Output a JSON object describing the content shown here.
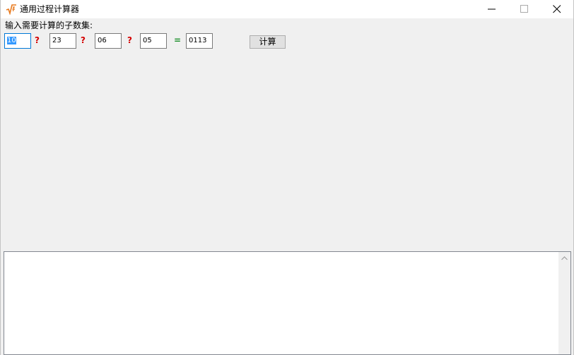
{
  "window": {
    "title": "通用过程计算器",
    "icon": "sqrt-function-icon"
  },
  "form": {
    "prompt": "输入需要计算的子数集:",
    "inputs": [
      "10",
      "23",
      "06",
      "05"
    ],
    "operators": [
      "?",
      "?",
      "?"
    ],
    "equals": "=",
    "result": "0113",
    "calc_button": "计算"
  },
  "colors": {
    "operator": "#d40000",
    "equals": "#1a8f2a",
    "selection": "#3399ff",
    "focus_border": "#0078d7"
  }
}
